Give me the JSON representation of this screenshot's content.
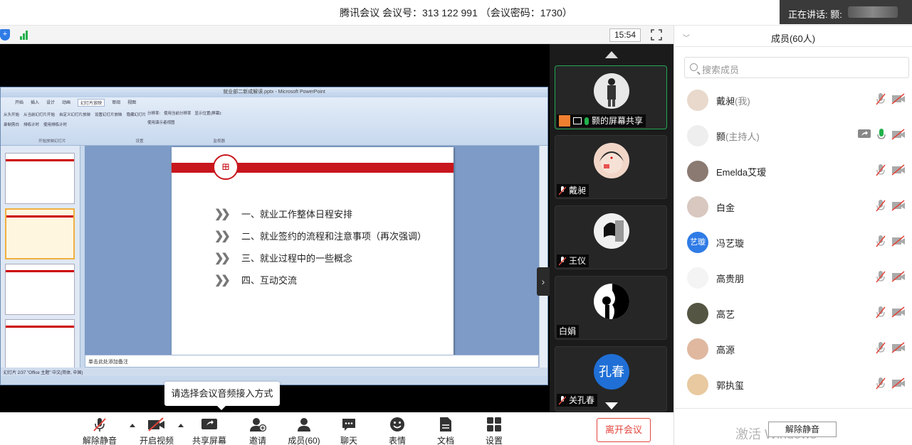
{
  "window": {
    "title": "腾讯会议 会议号：313 122 991 （会议密码：1730）"
  },
  "speaking": {
    "label": "正在讲话: 颢:"
  },
  "status": {
    "time": "15:54"
  },
  "ppt": {
    "window_title": "就业部二新成解读.pptx - Microsoft PowerPoint",
    "tabs": [
      "开始",
      "插入",
      "设计",
      "动画",
      "幻灯片放映",
      "审阅",
      "视图"
    ],
    "active_tab": "幻灯片放映",
    "ribbon_labels": [
      "从头开始",
      "从当前幻灯片开始",
      "自定义幻灯片放映",
      "设置幻灯片放映",
      "隐藏幻灯片",
      "录制旁白",
      "排练计时",
      "使用排练计时",
      "分辨率:",
      "使用当前分辨率",
      "显示位置(屏幕):",
      "使用演示者视图",
      "开始放映幻灯片",
      "设置",
      "监视器"
    ],
    "slide_items": [
      "一、就业工作整体日程安排",
      "二、就业签约的流程和注意事项（再次强调）",
      "三、就业过程中的一些概念",
      "四、互动交流"
    ],
    "notes_placeholder": "单击此处添加备注",
    "status_text": "幻灯片 2/37   \"Office 主题\"   中文(简体, 中国)"
  },
  "tooltip": "请选择会议音频接入方式",
  "video_tiles": [
    {
      "name": "颢的屏幕共享",
      "active": true
    },
    {
      "name": "戴昶",
      "active": false
    },
    {
      "name": "王仪",
      "active": false
    },
    {
      "name": "白娟",
      "active": false
    },
    {
      "name": "关孔春",
      "avatar_text": "孔春",
      "active": false
    }
  ],
  "members_panel": {
    "title": "成员(60人)",
    "search_placeholder": "搜索成员",
    "members": [
      {
        "name": "戴昶",
        "role": "(我)",
        "avatar_text": ""
      },
      {
        "name": "颢",
        "role": "(主持人)",
        "avatar_text": ""
      },
      {
        "name": "Emelda艾瑷",
        "role": "",
        "avatar_text": ""
      },
      {
        "name": "白金",
        "role": "",
        "avatar_text": ""
      },
      {
        "name": "冯艺璇",
        "role": "",
        "avatar_text": "艺璇"
      },
      {
        "name": "高贵朋",
        "role": "",
        "avatar_text": ""
      },
      {
        "name": "高艺",
        "role": "",
        "avatar_text": ""
      },
      {
        "name": "高源",
        "role": "",
        "avatar_text": ""
      },
      {
        "name": "郭执玺",
        "role": "",
        "avatar_text": ""
      }
    ],
    "unmute_all": "解除静音",
    "watermark": "激活 Windows"
  },
  "toolbar": {
    "unmute": "解除静音",
    "video": "开启视频",
    "share": "共享屏幕",
    "invite": "邀请",
    "members": "成员(60)",
    "chat": "聊天",
    "emoji": "表情",
    "docs": "文档",
    "settings": "设置",
    "leave": "离开会议"
  },
  "colors": {
    "accent": "#2f7be6",
    "danger": "#e2443b",
    "green": "#22b14c",
    "slide_red": "#c8161d"
  }
}
